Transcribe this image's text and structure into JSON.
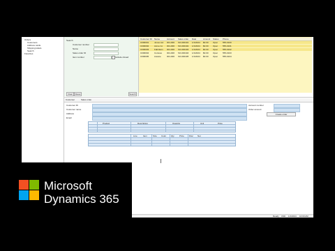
{
  "app": {
    "tree": [
      "Orders",
      "Customers",
      "Address cards",
      "Shipping labels",
      "Search",
      "Favorites"
    ]
  },
  "search_panel": {
    "title": "Search",
    "fields": [
      {
        "label": "Customer number"
      },
      {
        "label": "Name"
      },
      {
        "label": "Sales order ID"
      },
      {
        "label": "Item number"
      }
    ],
    "checkbox_label": "Include closed",
    "buttons": {
      "clear": "Clear",
      "reset": "Reset",
      "search": "Search"
    }
  },
  "results": {
    "columns": [
      "Customer ID",
      "Name",
      "Account",
      "Sales order",
      "Date",
      "Amount",
      "Status",
      "Phone"
    ],
    "rows": [
      [
        "C000001",
        "Jones Ltd",
        "001-000",
        "SO-000101",
        "1/1/2024",
        "$0.00",
        "Open",
        "555-0100"
      ],
      [
        "C000002",
        "Acme Co",
        "001-000",
        "SO-000102",
        "1/1/2024",
        "$0.00",
        "Open",
        "555-0101"
      ],
      [
        "C000003",
        "Fabrikam",
        "001-000",
        "SO-000103",
        "1/1/2024",
        "$0.00",
        "Open",
        "555-0102"
      ],
      [
        "C000004",
        "Contoso",
        "001-000",
        "SO-000104",
        "1/1/2024",
        "$0.00",
        "Open",
        "555-0103"
      ],
      [
        "C000005",
        "Litware",
        "001-000",
        "SO-000105",
        "1/1/2024",
        "$0.00",
        "Open",
        "555-0104"
      ]
    ]
  },
  "detail": {
    "tabs": [
      "Customer",
      "Sales order"
    ],
    "labels": [
      "Customer ID",
      "Customer name",
      "Address",
      "Email"
    ],
    "right_labels": [
      "Account number",
      "Order amount"
    ],
    "right_button": "Create order",
    "grid1_headers": [
      "Product",
      "Description",
      "Quantity",
      "Unit",
      "Price"
    ],
    "grid2_headers": [
      "Line",
      "Item",
      "Size",
      "Color",
      "Qty",
      "Price",
      "Disc",
      "Net"
    ]
  },
  "status": {
    "items": [
      "Ready",
      "USD",
      "1/1/2024",
      "10:00 AM"
    ]
  },
  "branding": {
    "line1": "Microsoft",
    "line2": "Dynamics 365",
    "colors": {
      "red": "#f25022",
      "green": "#7fba00",
      "blue": "#00a4ef",
      "yellow": "#ffb900"
    }
  }
}
